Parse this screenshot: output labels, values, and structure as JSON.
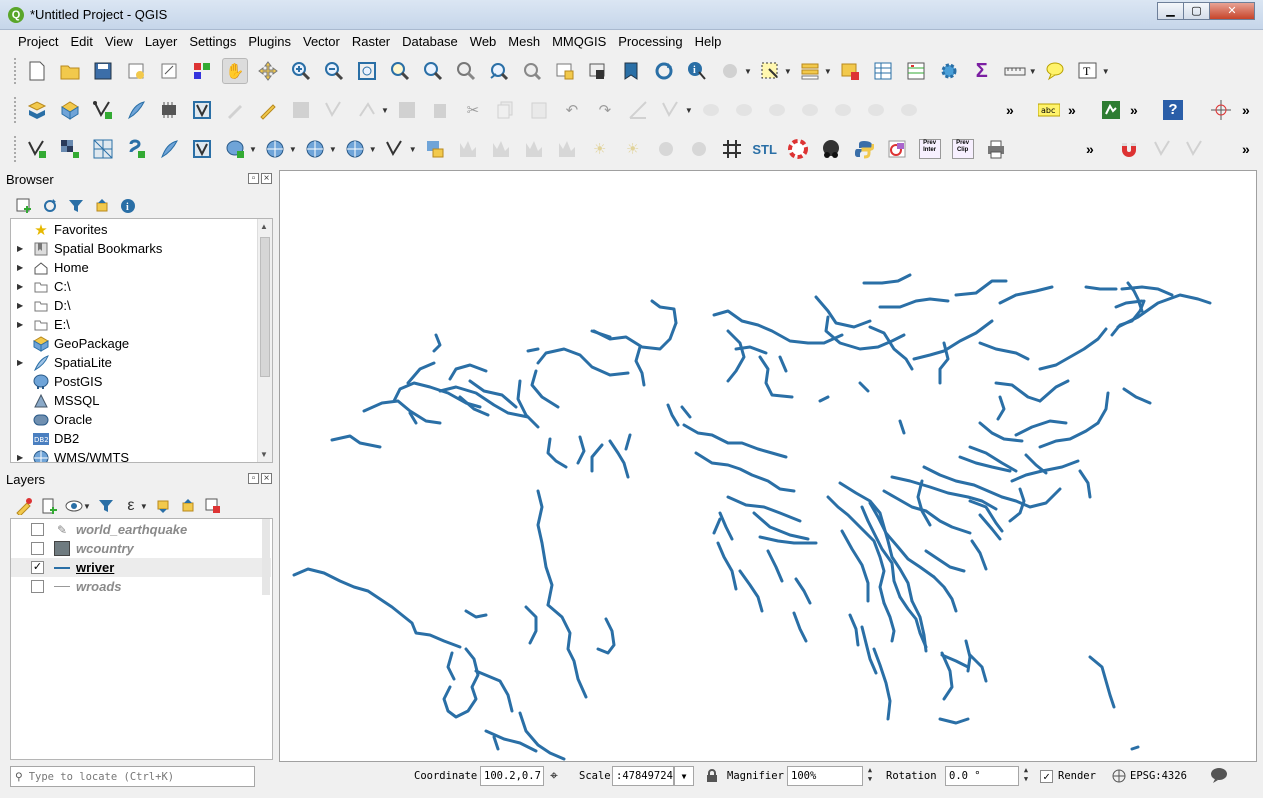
{
  "window": {
    "title": "*Untitled Project - QGIS",
    "minimize": "▁",
    "maximize": "▢",
    "close": "✕"
  },
  "menu": [
    "Project",
    "Edit",
    "View",
    "Layer",
    "Settings",
    "Plugins",
    "Vector",
    "Raster",
    "Database",
    "Web",
    "Mesh",
    "MMQGIS",
    "Processing",
    "Help"
  ],
  "toolbar_labels": {
    "stl": "STL",
    "prev_inter": "Prev Inter",
    "prev_clip": "Prev Clip",
    "abc": "abc",
    "help": "?",
    "more": "»"
  },
  "browser": {
    "title": "Browser",
    "items": [
      {
        "label": "Favorites",
        "icon": "star-icon",
        "expandable": false
      },
      {
        "label": "Spatial Bookmarks",
        "icon": "bookmark-icon",
        "expandable": true
      },
      {
        "label": "Home",
        "icon": "home-icon",
        "expandable": true
      },
      {
        "label": "C:\\",
        "icon": "folder-icon",
        "expandable": true
      },
      {
        "label": "D:\\",
        "icon": "folder-icon",
        "expandable": true
      },
      {
        "label": "E:\\",
        "icon": "folder-icon",
        "expandable": true
      },
      {
        "label": "GeoPackage",
        "icon": "geopackage-icon",
        "expandable": false
      },
      {
        "label": "SpatiaLite",
        "icon": "feather-icon",
        "expandable": true
      },
      {
        "label": "PostGIS",
        "icon": "elephant-icon",
        "expandable": false
      },
      {
        "label": "MSSQL",
        "icon": "mssql-icon",
        "expandable": false
      },
      {
        "label": "Oracle",
        "icon": "oracle-icon",
        "expandable": false
      },
      {
        "label": "DB2",
        "icon": "db2-icon",
        "expandable": false
      },
      {
        "label": "WMS/WMTS",
        "icon": "globe-icon",
        "expandable": true
      }
    ]
  },
  "layers": {
    "title": "Layers",
    "items": [
      {
        "name": "world_earthquake",
        "checked": false,
        "symbol": "point"
      },
      {
        "name": "wcountry",
        "checked": false,
        "symbol": "polygon"
      },
      {
        "name": "wriver",
        "checked": true,
        "symbol": "line-blue"
      },
      {
        "name": "wroads",
        "checked": false,
        "symbol": "line-grey"
      }
    ]
  },
  "status": {
    "locator_placeholder": "Type to locate (Ctrl+K)",
    "coordinate_label": "Coordinate",
    "coordinate_value": "100.2,0.7",
    "scale_label": "Scale",
    "scale_value": ":47849724",
    "magnifier_label": "Magnifier",
    "magnifier_value": "100%",
    "rotation_label": "Rotation",
    "rotation_value": "0.0 °",
    "render_label": "Render",
    "crs": "EPSG:4326"
  },
  "colors": {
    "river": "#2a6fa6",
    "accent": "#5aa62a"
  }
}
